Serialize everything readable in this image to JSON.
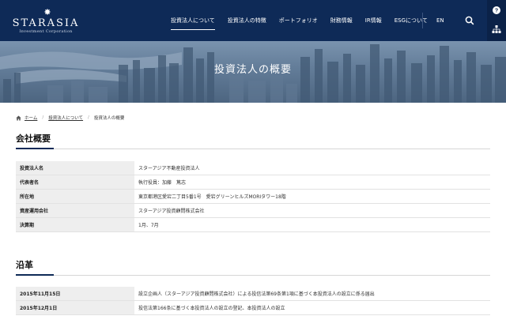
{
  "brand": {
    "logo_text": "STARASIA",
    "logo_subtext": "Investment Corporation"
  },
  "nav": {
    "items": [
      {
        "label": "投資法人について",
        "active": true
      },
      {
        "label": "投資法人の特徴",
        "active": false
      },
      {
        "label": "ポートフォリオ",
        "active": false
      },
      {
        "label": "財務情報",
        "active": false
      },
      {
        "label": "IR情報",
        "active": false
      },
      {
        "label": "ESGについて",
        "active": false
      }
    ],
    "lang": "EN",
    "search_icon": "search-icon"
  },
  "rail": {
    "top_icon": "help-icon",
    "bottom_icon": "sitemap-icon"
  },
  "hero": {
    "title": "投資法人の概要"
  },
  "breadcrumb": {
    "home": "ホーム",
    "level1": "投資法人について",
    "current": "投資法人の概要"
  },
  "company": {
    "heading": "会社概要",
    "rows": [
      {
        "label": "投資法人名",
        "value": "スターアジア不動産投資法人"
      },
      {
        "label": "代表者名",
        "value": "執行役員：加藤　篤志"
      },
      {
        "label": "所在地",
        "value": "東京都港区愛宕二丁目5番1号　愛宕グリーンヒルズMORIタワー18階"
      },
      {
        "label": "資産運用会社",
        "value": "スターアジア投資顧問株式会社"
      },
      {
        "label": "決算期",
        "value": "1月、7月"
      }
    ]
  },
  "history": {
    "heading": "沿革",
    "rows": [
      {
        "label": "2015年11月15日",
        "value": "設立企画人（スターアジア投資顧問株式会社）による投信法第69条第1項に基づく本投資法人の設立に係る届出"
      },
      {
        "label": "2015年12月1日",
        "value": "投信法第166条に基づく本投資法人の設立の登記、本投資法人の設立"
      }
    ]
  },
  "colors": {
    "header_bg": "#0e2a57",
    "accent": "#0e2a57",
    "label_bg": "#eeeeee"
  }
}
